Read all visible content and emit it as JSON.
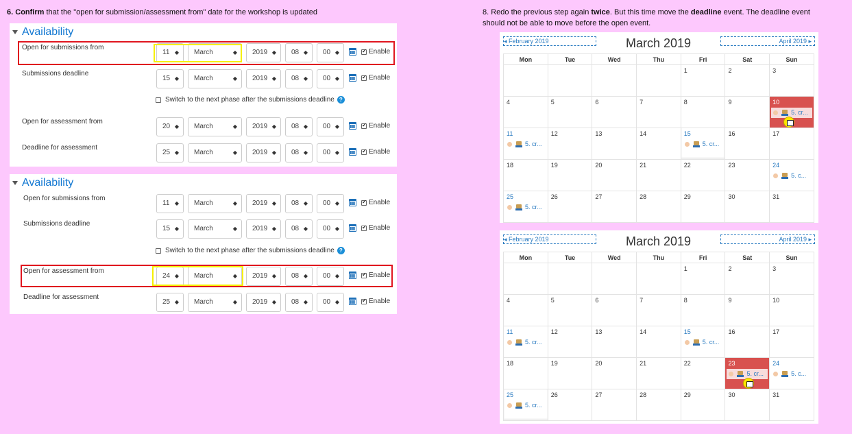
{
  "step6": {
    "num": "6.",
    "bold": "Confirm",
    "rest": " that the \"open for submission/assessment from\" date for the workshop is updated"
  },
  "step8": {
    "line1_a": "8. Redo the previous step again ",
    "line1_b": "twice",
    "line1_c": ". But this time move the ",
    "line1_d": "deadline",
    "line1_e": " event. The deadline event",
    "line2": "should not be able to move before the open event."
  },
  "panels": [
    {
      "title": "Availability",
      "rows": [
        {
          "label": "Open for submissions from",
          "day": "11",
          "month": "March",
          "year": "2019",
          "hour": "08",
          "minute": "00",
          "enable": "Enable"
        },
        {
          "label": "Submissions deadline",
          "day": "15",
          "month": "March",
          "year": "2019",
          "hour": "08",
          "minute": "00",
          "enable": "Enable"
        },
        {
          "label": "Open for assessment from",
          "day": "20",
          "month": "March",
          "year": "2019",
          "hour": "08",
          "minute": "00",
          "enable": "Enable"
        },
        {
          "label": "Deadline for assessment",
          "day": "25",
          "month": "March",
          "year": "2019",
          "hour": "08",
          "minute": "00",
          "enable": "Enable"
        }
      ],
      "switch_label": "Switch to the next phase after the submissions deadline"
    },
    {
      "title": "Availability",
      "rows": [
        {
          "label": "Open for submissions from",
          "day": "11",
          "month": "March",
          "year": "2019",
          "hour": "08",
          "minute": "00",
          "enable": "Enable"
        },
        {
          "label": "Submissions deadline",
          "day": "15",
          "month": "March",
          "year": "2019",
          "hour": "08",
          "minute": "00",
          "enable": "Enable"
        },
        {
          "label": "Open for assessment from",
          "day": "24",
          "month": "March",
          "year": "2019",
          "hour": "08",
          "minute": "00",
          "enable": "Enable"
        },
        {
          "label": "Deadline for assessment",
          "day": "25",
          "month": "March",
          "year": "2019",
          "hour": "08",
          "minute": "00",
          "enable": "Enable"
        }
      ],
      "switch_label": "Switch to the next phase after the submissions deadline"
    }
  ],
  "calendars": [
    {
      "prev": "◂  February 2019",
      "title": "March 2019",
      "next": "April 2019  ▸",
      "weekdays": [
        "Mon",
        "Tue",
        "Wed",
        "Thu",
        "Fri",
        "Sat",
        "Sun"
      ],
      "weeks": [
        [
          "",
          "",
          "",
          "",
          "1",
          "2",
          "3"
        ],
        [
          "4",
          "5",
          "6",
          "7",
          "8",
          "9",
          "10"
        ],
        [
          "11",
          "12",
          "13",
          "14",
          "15",
          "16",
          "17"
        ],
        [
          "18",
          "19",
          "20",
          "21",
          "22",
          "23",
          "24"
        ],
        [
          "25",
          "26",
          "27",
          "28",
          "29",
          "30",
          "31"
        ]
      ],
      "event_label_long": "5. cr...",
      "event_label_short": "5. c..."
    },
    {
      "prev": "◂  February 2019",
      "title": "March 2019",
      "next": "April 2019  ▸",
      "weekdays": [
        "Mon",
        "Tue",
        "Wed",
        "Thu",
        "Fri",
        "Sat",
        "Sun"
      ],
      "weeks": [
        [
          "",
          "",
          "",
          "",
          "1",
          "2",
          "3"
        ],
        [
          "4",
          "5",
          "6",
          "7",
          "8",
          "9",
          "10"
        ],
        [
          "11",
          "12",
          "13",
          "14",
          "15",
          "16",
          "17"
        ],
        [
          "18",
          "19",
          "20",
          "21",
          "22",
          "23",
          "24"
        ],
        [
          "25",
          "26",
          "27",
          "28",
          "29",
          "30",
          "31"
        ]
      ],
      "event_label_long": "5. cr...",
      "event_label_short": "5. c..."
    }
  ],
  "colors": {
    "background": "#fdc8fd",
    "accent": "#1177d1",
    "highlight_day": "#d8514f",
    "red_box": "#e0141e",
    "yellow_box": "#f6f000"
  }
}
